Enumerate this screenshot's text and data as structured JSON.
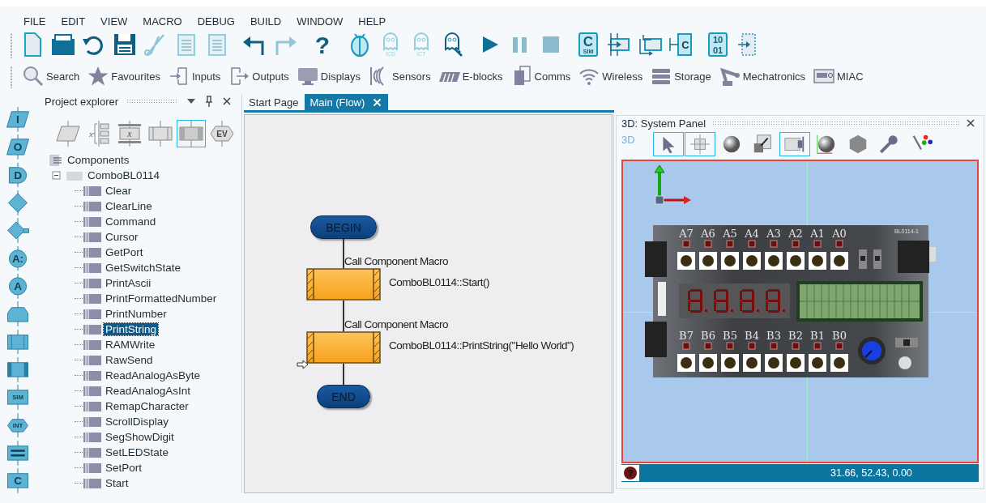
{
  "menu": [
    "FILE",
    "EDIT",
    "VIEW",
    "MACRO",
    "DEBUG",
    "BUILD",
    "WINDOW",
    "HELP"
  ],
  "toolbar": [
    {
      "kind": "new-file",
      "disabled": false
    },
    {
      "kind": "open-folder",
      "disabled": false
    },
    {
      "kind": "revert",
      "disabled": false
    },
    {
      "kind": "save",
      "disabled": false
    },
    {
      "kind": "cut",
      "disabled": true
    },
    {
      "kind": "copy",
      "disabled": true
    },
    {
      "kind": "paste",
      "disabled": true
    },
    {
      "kind": "undo",
      "disabled": false
    },
    {
      "kind": "redo",
      "disabled": true
    },
    {
      "kind": "help",
      "glyph": "?",
      "disabled": false
    },
    {
      "kind": "bug",
      "disabled": false
    },
    {
      "kind": "ghost",
      "sub": "ICD",
      "disabled": true
    },
    {
      "kind": "ghost",
      "sub": "ICT",
      "disabled": true
    },
    {
      "kind": "ghost-key",
      "disabled": false
    },
    {
      "kind": "play",
      "disabled": false
    },
    {
      "kind": "pause",
      "disabled": true
    },
    {
      "kind": "stop",
      "disabled": true
    },
    {
      "kind": "chip",
      "glyph": "C",
      "sub": "SIM",
      "disabled": false
    },
    {
      "kind": "step-into",
      "disabled": false
    },
    {
      "kind": "step-over",
      "disabled": false
    },
    {
      "kind": "step-out",
      "glyph": "C",
      "disabled": false
    },
    {
      "kind": "chip",
      "glyph": "10",
      "sub": "01",
      "disabled": false
    },
    {
      "kind": "step-end",
      "disabled": false
    }
  ],
  "categories": [
    {
      "kind": "search",
      "label": "Search"
    },
    {
      "kind": "star",
      "label": "Favourites"
    },
    {
      "kind": "input",
      "label": "Inputs"
    },
    {
      "kind": "output",
      "label": "Outputs"
    },
    {
      "kind": "monitor",
      "label": "Displays"
    },
    {
      "kind": "waves",
      "label": "Sensors"
    },
    {
      "kind": "stripes",
      "label": "E-blocks"
    },
    {
      "kind": "chips",
      "label": "Comms"
    },
    {
      "kind": "wifi",
      "label": "Wireless"
    },
    {
      "kind": "stack",
      "label": "Storage"
    },
    {
      "kind": "robot-arm",
      "label": "Mechatronics"
    },
    {
      "kind": "device",
      "label": "MIAC"
    }
  ],
  "palette": [
    {
      "kind": "para",
      "glyph": "I"
    },
    {
      "kind": "para",
      "glyph": "O"
    },
    {
      "kind": "delay",
      "glyph": "D"
    },
    {
      "kind": "diamond"
    },
    {
      "kind": "diamond-key"
    },
    {
      "kind": "circle",
      "glyph": "A:"
    },
    {
      "kind": "circle",
      "glyph": "A"
    },
    {
      "kind": "loop"
    },
    {
      "kind": "macro"
    },
    {
      "kind": "component"
    },
    {
      "kind": "label",
      "glyph": "SIM"
    },
    {
      "kind": "hex",
      "glyph": "INT"
    },
    {
      "kind": "equals"
    },
    {
      "kind": "label",
      "glyph": "C"
    }
  ],
  "explorer": {
    "title": "Project explorer",
    "views": [
      {
        "kind": "parallelogram",
        "selected": false
      },
      {
        "kind": "variables",
        "glyph": "x",
        "selected": false
      },
      {
        "kind": "expression",
        "glyph": "x",
        "selected": false
      },
      {
        "kind": "macro",
        "selected": false
      },
      {
        "kind": "component",
        "selected": true
      },
      {
        "kind": "event",
        "glyph": "EV",
        "selected": false
      }
    ],
    "root": "Components",
    "folder": {
      "label": "ComboBL0114",
      "expanded": true,
      "children": [
        {
          "label": "Clear",
          "selected": false
        },
        {
          "label": "ClearLine",
          "selected": false
        },
        {
          "label": "Command",
          "selected": false
        },
        {
          "label": "Cursor",
          "selected": false
        },
        {
          "label": "GetPort",
          "selected": false
        },
        {
          "label": "GetSwitchState",
          "selected": false
        },
        {
          "label": "PrintAscii",
          "selected": false
        },
        {
          "label": "PrintFormattedNumber",
          "selected": false
        },
        {
          "label": "PrintNumber",
          "selected": false
        },
        {
          "label": "PrintString",
          "selected": true
        },
        {
          "label": "RAMWrite",
          "selected": false
        },
        {
          "label": "RawSend",
          "selected": false
        },
        {
          "label": "ReadAnalogAsByte",
          "selected": false
        },
        {
          "label": "ReadAnalogAsInt",
          "selected": false
        },
        {
          "label": "RemapCharacter",
          "selected": false
        },
        {
          "label": "ScrollDisplay",
          "selected": false
        },
        {
          "label": "SegShowDigit",
          "selected": false
        },
        {
          "label": "SetLEDState",
          "selected": false
        },
        {
          "label": "SetPort",
          "selected": false
        },
        {
          "label": "Start",
          "selected": false
        }
      ]
    }
  },
  "tabs": [
    {
      "label": "Start Page",
      "selected": false,
      "closable": false
    },
    {
      "label": "Main (Flow)",
      "selected": true,
      "closable": true
    }
  ],
  "flowchart": [
    {
      "kind": "terminal",
      "label": "BEGIN"
    },
    {
      "kind": "macro",
      "title": "Call Component Macro",
      "detail": "ComboBL0114::Start()"
    },
    {
      "kind": "macro",
      "title": "Call Component Macro",
      "detail": "ComboBL0114::PrintString(\"Hello World\")"
    },
    {
      "kind": "terminal",
      "label": "END"
    }
  ],
  "system_panel": {
    "title": "3D: System Panel",
    "mode_label": "3D",
    "tools": [
      {
        "kind": "pointer",
        "on": true
      },
      {
        "kind": "move",
        "on": true
      },
      {
        "kind": "orbit",
        "on": false
      },
      {
        "kind": "scale",
        "on": false
      },
      {
        "kind": "camera",
        "on": true
      },
      {
        "kind": "axis-sphere",
        "on": false
      },
      {
        "kind": "cube",
        "on": false
      },
      {
        "kind": "wrench",
        "on": false
      },
      {
        "kind": "brush",
        "on": false
      }
    ],
    "board": {
      "part_label": "BL0114-1",
      "top_labels": [
        "A7",
        "A6",
        "A5",
        "A4",
        "A3",
        "A2",
        "A1",
        "A0"
      ],
      "bottom_labels": [
        "B7",
        "B6",
        "B5",
        "B4",
        "B3",
        "B2",
        "B1",
        "B0"
      ]
    },
    "status": {
      "help_glyph": "?",
      "coordinates": "31.66, 52.43, 0.00"
    }
  }
}
